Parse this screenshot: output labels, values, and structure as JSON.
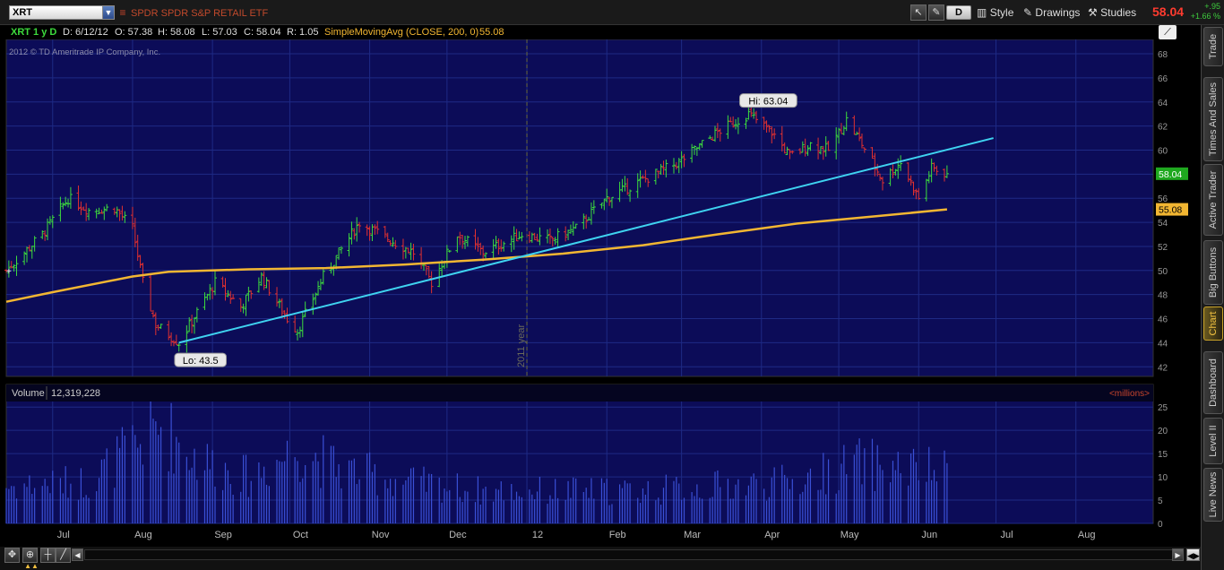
{
  "toolbar": {
    "symbol": "XRT",
    "description": "SPDR SPDR S&P RETAIL ETF",
    "icons": [
      "cursor-icon",
      "wrench-icon"
    ],
    "period_button": "D",
    "style_label": "Style",
    "drawings_label": "Drawings",
    "studies_label": "Studies",
    "last_price": "58.04",
    "change_abs": "+.95",
    "change_pct": "+1.66 %"
  },
  "infobar": {
    "symbol_period": "XRT 1 y D",
    "date": "D: 6/12/12",
    "open": "O: 57.38",
    "high": "H: 58.08",
    "low": "L: 57.03",
    "close": "C: 58.04",
    "range": "R: 1.05",
    "study": "SimpleMovingAvg (CLOSE, 200, 0)",
    "study_value": "55.08"
  },
  "chart": {
    "copyright": "2012 © TD Ameritrade IP Company, Inc.",
    "year_marker": "2011 year",
    "hi_label": "Hi: 63.04",
    "lo_label": "Lo: 43.5",
    "price_badge": "58.04",
    "sma_badge": "55.08",
    "volume_label": "Volume",
    "volume_value": "12,319,228",
    "volume_units": "<millions>",
    "colors": {
      "background": "#0c0c58",
      "up": "#3ddc3d",
      "down": "#e03030",
      "sma": "#f2b632",
      "trendline": "#3fd3f0",
      "volume": "#3a50d6"
    }
  },
  "chart_data": {
    "type": "candlestick",
    "price_axis": {
      "ticks": [
        42,
        44,
        46,
        48,
        50,
        52,
        54,
        56,
        58,
        60,
        62,
        64,
        66,
        68
      ],
      "range": [
        41.2,
        68.6
      ]
    },
    "volume_axis": {
      "ticks": [
        0,
        5,
        10,
        15,
        20,
        25
      ],
      "range": [
        0,
        26
      ]
    },
    "x_labels": [
      "Jul",
      "Aug",
      "Sep",
      "Oct",
      "Nov",
      "Dec",
      "12",
      "Feb",
      "Mar",
      "Apr",
      "May",
      "Jun",
      "Jul",
      "Aug"
    ],
    "x_axis_range": [
      "2011-06-13",
      "2012-08-31"
    ],
    "hi": 63.04,
    "lo": 43.5,
    "last_close": 58.04,
    "sma_last": 55.08,
    "trendline": [
      {
        "date": "2011-08-19",
        "price": 44.0
      },
      {
        "date": "2012-06-30",
        "price": 61.0
      }
    ],
    "sma_points": [
      [
        "2011-06-13",
        47.4
      ],
      [
        "2011-07-01",
        48.2
      ],
      [
        "2011-08-01",
        49.5
      ],
      [
        "2011-08-15",
        49.9
      ],
      [
        "2011-09-15",
        50.1
      ],
      [
        "2011-10-15",
        50.2
      ],
      [
        "2011-11-15",
        50.5
      ],
      [
        "2011-12-15",
        50.9
      ],
      [
        "2012-01-15",
        51.4
      ],
      [
        "2012-02-15",
        52.1
      ],
      [
        "2012-03-15",
        53.0
      ],
      [
        "2012-04-15",
        53.9
      ],
      [
        "2012-05-15",
        54.5
      ],
      [
        "2012-06-12",
        55.08
      ]
    ],
    "close_path": [
      [
        "2011-06-13",
        50.0
      ],
      [
        "2011-06-27",
        53.0
      ],
      [
        "2011-07-07",
        56.0
      ],
      [
        "2011-07-15",
        55.0
      ],
      [
        "2011-07-25",
        55.2
      ],
      [
        "2011-08-01",
        53.5
      ],
      [
        "2011-08-05",
        49.0
      ],
      [
        "2011-08-10",
        45.5
      ],
      [
        "2011-08-19",
        44.0
      ],
      [
        "2011-08-26",
        46.5
      ],
      [
        "2011-09-02",
        49.0
      ],
      [
        "2011-09-12",
        47.0
      ],
      [
        "2011-09-20",
        49.5
      ],
      [
        "2011-09-30",
        46.0
      ],
      [
        "2011-10-04",
        45.0
      ],
      [
        "2011-10-14",
        49.5
      ],
      [
        "2011-10-28",
        54.0
      ],
      [
        "2011-11-05",
        53.0
      ],
      [
        "2011-11-18",
        51.5
      ],
      [
        "2011-11-25",
        49.0
      ],
      [
        "2011-12-05",
        53.0
      ],
      [
        "2011-12-15",
        51.5
      ],
      [
        "2011-12-30",
        53.0
      ],
      [
        "2012-01-10",
        52.5
      ],
      [
        "2012-01-20",
        53.5
      ],
      [
        "2012-02-01",
        56.0
      ],
      [
        "2012-02-15",
        57.5
      ],
      [
        "2012-02-29",
        59.0
      ],
      [
        "2012-03-15",
        61.5
      ],
      [
        "2012-03-27",
        63.0
      ],
      [
        "2012-04-05",
        61.5
      ],
      [
        "2012-04-12",
        59.5
      ],
      [
        "2012-04-20",
        60.5
      ],
      [
        "2012-04-27",
        60.0
      ],
      [
        "2012-05-04",
        62.5
      ],
      [
        "2012-05-10",
        60.5
      ],
      [
        "2012-05-18",
        57.5
      ],
      [
        "2012-05-25",
        59.0
      ],
      [
        "2012-06-01",
        56.0
      ],
      [
        "2012-06-06",
        58.5
      ],
      [
        "2012-06-12",
        58.04
      ]
    ],
    "volume_path": [
      [
        "2011-06-13",
        8
      ],
      [
        "2011-07-15",
        9
      ],
      [
        "2011-08-05",
        18
      ],
      [
        "2011-08-12",
        21
      ],
      [
        "2011-08-26",
        14
      ],
      [
        "2011-09-15",
        10
      ],
      [
        "2011-10-04",
        16
      ],
      [
        "2011-10-20",
        12
      ],
      [
        "2011-11-15",
        9
      ],
      [
        "2011-12-15",
        7
      ],
      [
        "2012-01-15",
        7
      ],
      [
        "2012-02-15",
        7
      ],
      [
        "2012-03-15",
        8
      ],
      [
        "2012-04-15",
        9
      ],
      [
        "2012-05-08",
        13
      ],
      [
        "2012-05-25",
        12
      ],
      [
        "2012-06-12",
        11
      ]
    ]
  },
  "side_tabs": [
    "Trade",
    "Times And Sales",
    "Active Trader",
    "Big Buttons",
    "Chart",
    "Dashboard",
    "Level II",
    "Live News"
  ],
  "active_side_tab": "Chart"
}
